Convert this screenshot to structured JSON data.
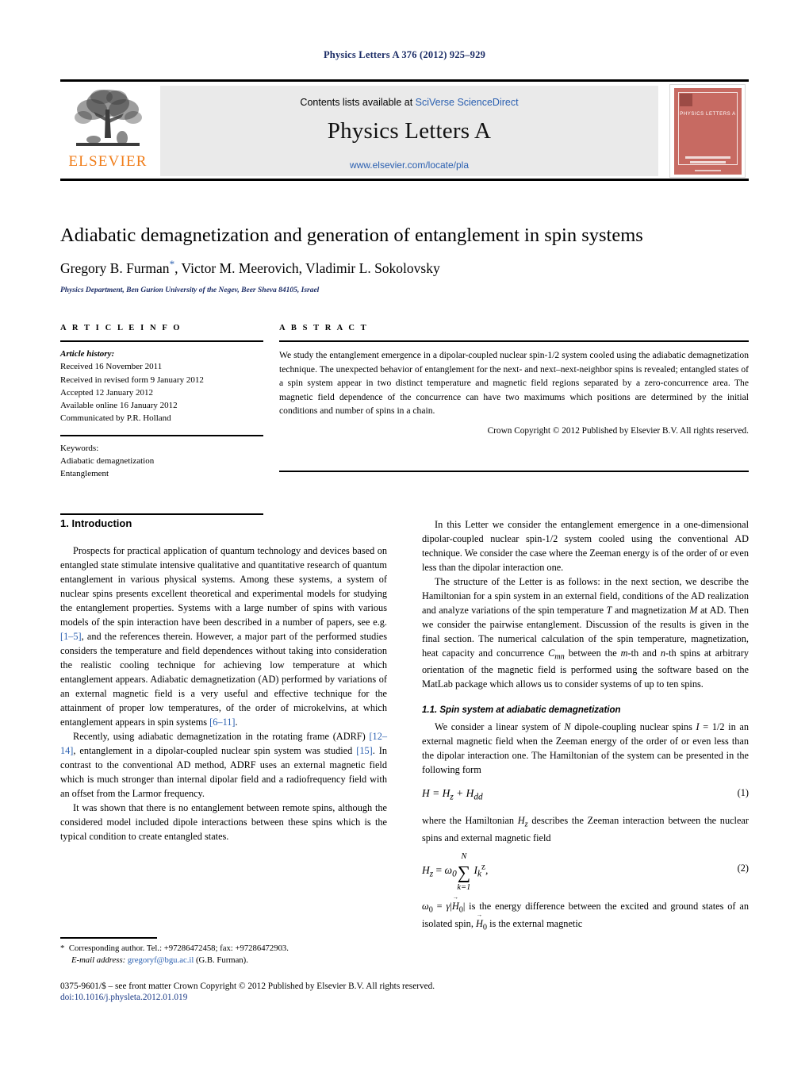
{
  "running_head": "Physics Letters A 376 (2012) 925–929",
  "masthead": {
    "publisher_name": "ELSEVIER",
    "contents_prefix": "Contents lists available at ",
    "contents_link": "SciVerse ScienceDirect",
    "journal_name": "Physics Letters A",
    "journal_url": "www.elsevier.com/locate/pla",
    "cover_title": "PHYSICS LETTERS A"
  },
  "title_block": {
    "title": "Adiabatic demagnetization and generation of entanglement in spin systems",
    "authors_part1": "Gregory B. Furman",
    "authors_star": "*",
    "authors_part2": ", Victor M. Meerovich, Vladimir L. Sokolovsky",
    "affiliation": "Physics Department, Ben Gurion University of the Negev, Beer Sheva 84105, Israel"
  },
  "article_info": {
    "heading": "A R T I C L E    I N F O",
    "history_label": "Article history:",
    "history": [
      "Received 16 November 2011",
      "Received in revised form 9 January 2012",
      "Accepted 12 January 2012",
      "Available online 16 January 2012",
      "Communicated by P.R. Holland"
    ],
    "keywords_label": "Keywords:",
    "keywords": [
      "Adiabatic demagnetization",
      "Entanglement"
    ]
  },
  "abstract": {
    "heading": "A B S T R A C T",
    "text": "We study the entanglement emergence in a dipolar-coupled nuclear spin-1/2 system cooled using the adiabatic demagnetization technique. The unexpected behavior of entanglement for the next- and next–next-neighbor spins is revealed; entangled states of a spin system appear in two distinct temperature and magnetic field regions separated by a zero-concurrence area. The magnetic field dependence of the concurrence can have two maximums which positions are determined by the initial conditions and number of spins in a chain.",
    "copyright": "Crown Copyright © 2012 Published by Elsevier B.V. All rights reserved."
  },
  "left_column": {
    "section_heading": "1. Introduction",
    "para1_a": "Prospects for practical application of quantum technology and devices based on entangled state stimulate intensive qualitative and quantitative research of quantum entanglement in various physical systems. Among these systems, a system of nuclear spins presents excellent theoretical and experimental models for studying the entanglement properties. Systems with a large number of spins with various models of the spin interaction have been described in a number of papers, see e.g. ",
    "para1_ref1": "[1–5]",
    "para1_b": ", and the references therein. However, a major part of the performed studies considers the temperature and field dependences without taking into consideration the realistic cooling technique for achieving low temperature at which entanglement appears. Adiabatic demagnetization (AD) performed by variations of an external magnetic field is a very useful and effective technique for the attainment of proper low temperatures, of the order of microkelvins, at which entanglement appears in spin systems ",
    "para1_ref2": "[6–11]",
    "para1_c": ".",
    "para2_a": "Recently, using adiabatic demagnetization in the rotating frame (ADRF) ",
    "para2_ref1": "[12–14]",
    "para2_b": ", entanglement in a dipolar-coupled nuclear spin system was studied ",
    "para2_ref2": "[15]",
    "para2_c": ". In contrast to the conventional AD method, ADRF uses an external magnetic field which is much stronger than internal dipolar field and a radiofrequency field with an offset from the Larmor frequency.",
    "para3": "It was shown that there is no entanglement between remote spins, although the considered model included dipole interactions between these spins which is the typical condition to create entangled states."
  },
  "right_column": {
    "para1": "In this Letter we consider the entanglement emergence in a one-dimensional dipolar-coupled nuclear spin-1/2 system cooled using the conventional AD technique. We consider the case where the Zeeman energy is of the order of or even less than the dipolar interaction one.",
    "para2": "The structure of the Letter is as follows: in the next section, we describe the Hamiltonian for a spin system in an external field, conditions of the AD realization and analyze variations of the spin temperature T and magnetization M at AD. Then we consider the pairwise entanglement. Discussion of the results is given in the final section. The numerical calculation of the spin temperature, magnetization, heat capacity and concurrence Cmn between the m-th and n-th spins at arbitrary orientation of the magnetic field is performed using the software based on the MatLab package which allows us to consider systems of up to ten spins.",
    "subsection_heading": "1.1. Spin system at adiabatic demagnetization",
    "para3": "We consider a linear system of N dipole-coupling nuclear spins I = 1/2 in an external magnetic field when the Zeeman energy of the order of or even less than the dipolar interaction one. The Hamiltonian of the system can be presented in the following form",
    "eq1": "H = Hz + Hdd",
    "eq1_num": "(1)",
    "para4": "where the Hamiltonian Hz describes the Zeeman interaction between the nuclear spins and external magnetic field",
    "eq2_num": "(2)",
    "para5": "ω0 = γ|H0| is the energy difference between the excited and ground states of an isolated spin, H0 is the external magnetic"
  },
  "footnote": {
    "corresponding": "Corresponding author. Tel.: +97286472458; fax: +97286472903.",
    "email_label": "E-mail address:",
    "email": "gregoryf@bgu.ac.il",
    "email_suffix": "(G.B. Furman)."
  },
  "page_footer": {
    "line1": "0375-9601/$ – see front matter  Crown Copyright © 2012 Published by Elsevier B.V. All rights reserved.",
    "doi": "doi:10.1016/j.physleta.2012.01.019"
  }
}
